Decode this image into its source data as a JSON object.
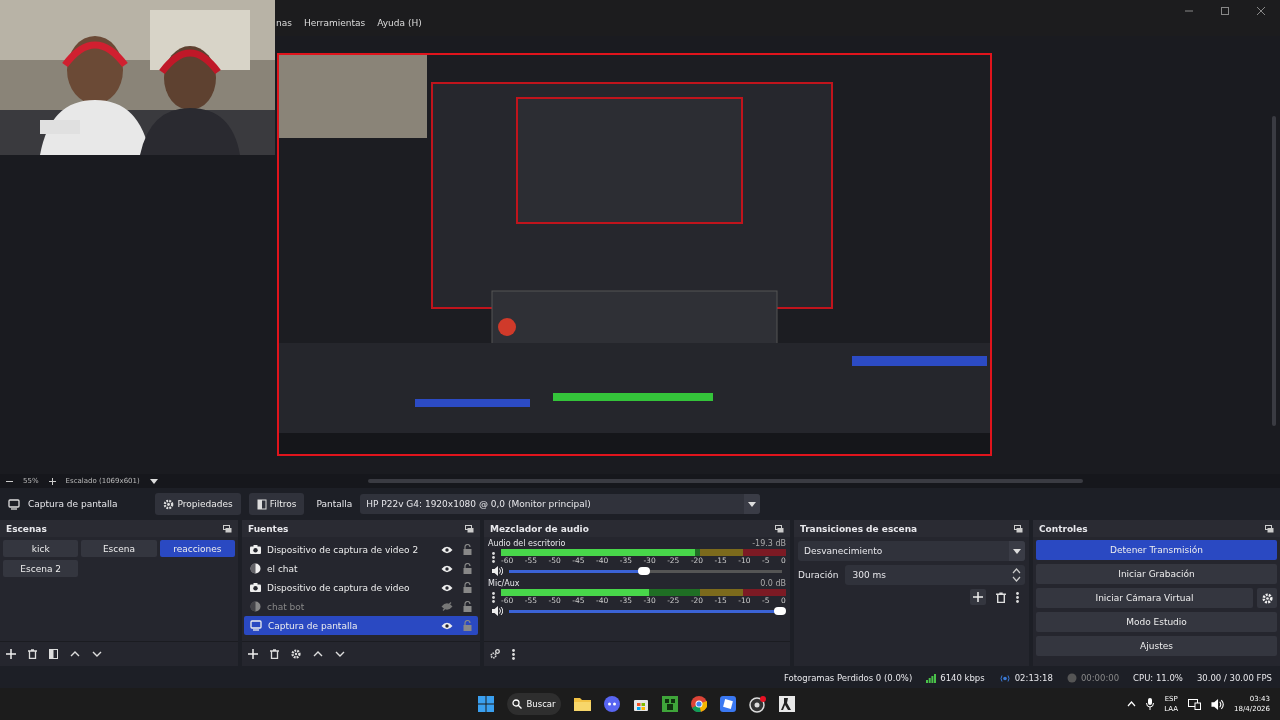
{
  "menu": [
    "nas",
    "Herramientas",
    "Ayuda (H)"
  ],
  "zoom_bar": {
    "zoom": "55%",
    "scale": "Escalado (1069x601)"
  },
  "source_toolbar": {
    "source": "Captura de pantalla",
    "buttons": [
      "Propiedades",
      "Filtros"
    ],
    "label": "Pantalla",
    "value": "HP P22v G4: 1920x1080 @ 0,0 (Monitor principal)"
  },
  "scenes": {
    "title": "Escenas",
    "items": [
      {
        "label": "kick",
        "selected": false
      },
      {
        "label": "Escena",
        "selected": false
      },
      {
        "label": "reacciones",
        "selected": true
      },
      {
        "label": "Escena 2",
        "selected": false
      }
    ]
  },
  "sources": {
    "title": "Fuentes",
    "items": [
      {
        "name": "Dispositivo de captura de video 2",
        "kind": "camera",
        "visible": true,
        "selected": false
      },
      {
        "name": "el chat",
        "kind": "browser",
        "visible": true,
        "selected": false
      },
      {
        "name": "Dispositivo de captura de video",
        "kind": "camera",
        "visible": true,
        "selected": false
      },
      {
        "name": "chat bot",
        "kind": "browser",
        "visible": false,
        "selected": false
      },
      {
        "name": "Captura de pantalla",
        "kind": "display",
        "visible": true,
        "selected": true
      }
    ]
  },
  "mixer": {
    "title": "Mezclador de audio",
    "channels": [
      {
        "name": "Audio del escritorio",
        "reading": "-19.3 dB",
        "meter": {
          "level": 0.68
        },
        "volume": {
          "level": 0.5
        },
        "ticks": [
          "-60",
          "-55",
          "-50",
          "-45",
          "-40",
          "-35",
          "-30",
          "-25",
          "-20",
          "-15",
          "-10",
          "-5",
          "0"
        ]
      },
      {
        "name": "Mic/Aux",
        "reading": "0.0 dB",
        "meter": {
          "level": 0.52
        },
        "volume": {
          "level": 1
        },
        "ticks": [
          "-60",
          "-55",
          "-50",
          "-45",
          "-40",
          "-35",
          "-30",
          "-25",
          "-20",
          "-15",
          "-10",
          "-5",
          "0"
        ]
      }
    ]
  },
  "transitions": {
    "title": "Transiciones de escena",
    "transition": "Desvanecimiento",
    "duration_label": "Duración",
    "duration": "300 ms"
  },
  "controls": {
    "title": "Controles",
    "buttons": [
      {
        "label": "Detener Transmisión",
        "active": true,
        "settings": false
      },
      {
        "label": "Iniciar Grabación",
        "active": false,
        "settings": false
      },
      {
        "label": "Iniciar Cámara Virtual",
        "active": false,
        "settings": true
      },
      {
        "label": "Modo Estudio",
        "active": false,
        "settings": false
      },
      {
        "label": "Ajustes",
        "active": false,
        "settings": false
      }
    ]
  },
  "status_bar": {
    "dropped": "Fotogramas Perdidos 0 (0.0%)",
    "bitrate": "6140 kbps",
    "stream_time": "02:13:18",
    "record_time": "00:00:00",
    "cpu": "CPU: 11.0%",
    "fps": "30.00 / 30.00 FPS"
  },
  "taskbar": {
    "search": "Buscar",
    "language": "ESP",
    "layout": "LAA",
    "time": "03:43",
    "date": "18/4/2026"
  }
}
